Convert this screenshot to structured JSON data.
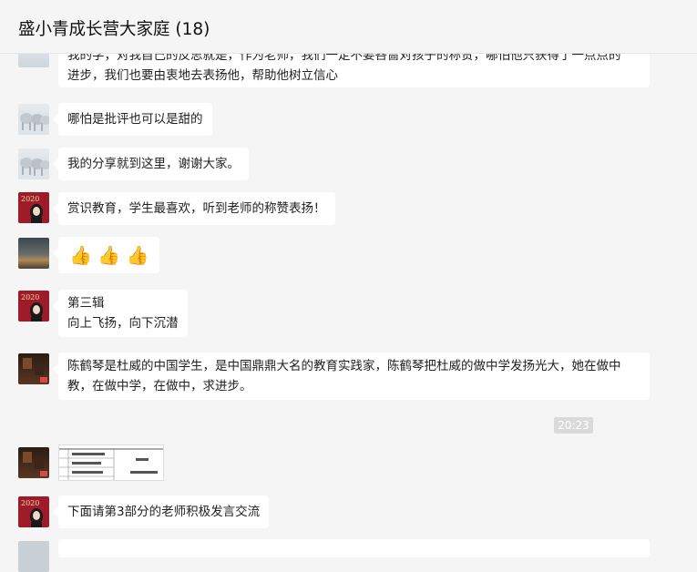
{
  "header": {
    "title": "盛小青成长营大家庭 (18)"
  },
  "messages": [
    {
      "text_line1": "我的学，对我自己的反思就是，作为老师，我们一定不要吝啬对孩子的称赞，哪怕他只获得了一点点的",
      "text_line2": "进步，我们也要由衷地去表扬他，帮助他树立信心"
    },
    {
      "text": "哪怕是批评也可以是甜的"
    },
    {
      "text": "我的分享就到这里，谢谢大家。"
    },
    {
      "text": "赏识教育，学生最喜欢，听到老师的称赞表扬！"
    },
    {
      "emoji": "👍 👍 👍"
    },
    {
      "line1": "第三辑",
      "line2": "向上飞扬，向下沉潜"
    },
    {
      "line1": "陈鹤琴是杜威的中国学生，是中国鼎鼎大名的教育实践家，陈鹤琴把杜威的做中学发扬光大，她在做中",
      "line2": "教，在做中学，在做中，求进步。"
    },
    {
      "text": "下面请第3部分的老师积极发言交流"
    }
  ],
  "timestamp": "20:23",
  "avatar_badge": "2020",
  "thumb_emoji": "👍",
  "colors": {
    "background": "#f5f5f5",
    "bubble": "#ffffff",
    "timestamp_bg": "#dadada"
  }
}
